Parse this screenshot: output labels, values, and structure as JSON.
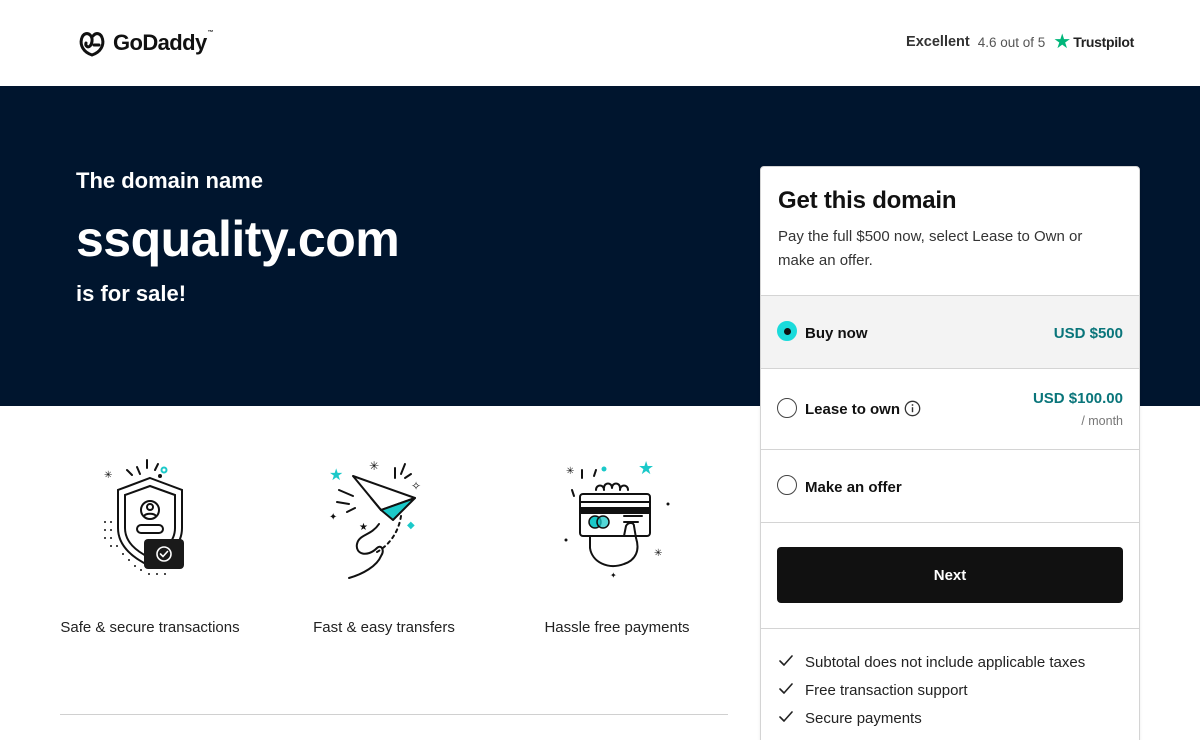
{
  "header": {
    "logo_text": "GoDaddy",
    "logo_tm": "™",
    "trustpilot": {
      "label": "Excellent",
      "rating": "4.6 out of 5",
      "star": "★",
      "brand": "Trustpilot",
      "star_color": "#00b67a"
    }
  },
  "hero": {
    "pre": "The domain name",
    "domain": "ssquality.com",
    "post": "is for sale!",
    "background": "#00152e"
  },
  "features": [
    {
      "icon": "shield-icon",
      "label": "Safe & secure transactions"
    },
    {
      "icon": "paper-plane-icon",
      "label": "Fast & easy transfers"
    },
    {
      "icon": "card-payment-icon",
      "label": "Hassle free payments"
    }
  ],
  "card": {
    "title": "Get this domain",
    "subtitle": "Pay the full $500 now, select Lease to Own or make an offer.",
    "options": {
      "buy": {
        "label": "Buy now",
        "price": "USD $500",
        "selected": true
      },
      "lease": {
        "label": "Lease to own",
        "price": "USD $100.00",
        "period": "/ month",
        "selected": false
      },
      "offer": {
        "label": "Make an offer",
        "selected": false
      }
    },
    "next_label": "Next",
    "benefits": [
      "Subtotal does not include applicable taxes",
      "Free transaction support",
      "Secure payments"
    ],
    "accent_color": "#1bdbdb",
    "price_color": "#09757a"
  }
}
